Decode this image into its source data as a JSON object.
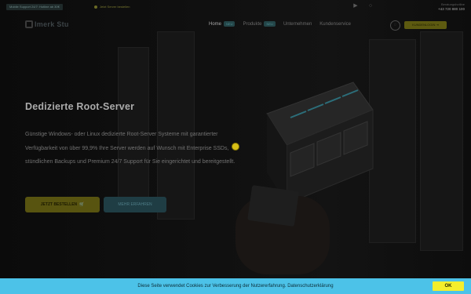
{
  "topbar": {
    "phone_badge": "Mobile Support 24/7: Hotline ab 30€",
    "offer_text": "Jetzt Server bestellen",
    "icon_bell": "bell-icon",
    "icon_user": "user-icon",
    "hotline_label": "Beratungshotline",
    "hotline_number": "+43 720 880 100"
  },
  "brand": {
    "name": "Imerk Stu"
  },
  "nav": {
    "items": [
      {
        "label": "Home",
        "pill": "NEU",
        "active": true
      },
      {
        "label": "Produkte",
        "pill": "NEU",
        "active": false
      },
      {
        "label": "Unternehmen",
        "pill": "",
        "active": false
      },
      {
        "label": "Kundenservice",
        "pill": "",
        "active": false
      }
    ],
    "circle_icon": "menu-circle-icon",
    "cta_label": "KUNDENLOGIN ⇥"
  },
  "hero": {
    "title": "Dedizierte Root-Server",
    "description": "Günstige Windows- oder Linux dedizierte Root-Server Systeme mit garantierter Verfügbarkeit von über 99,9% Ihre Server werden auf Wunsch mit Enterprise SSDs, stündlichen Backups und Premium 24/7 Support für Sie eingerichtet und bereitgestellt.",
    "primary_button": "JETZT BESTELLEN",
    "primary_icon": "cart-icon",
    "secondary_button": "MEHR ERFAHREN"
  },
  "cookie": {
    "text": "Diese Seite verwendet Cookies zur Verbesserung der Nutzererfahrung.",
    "link": "Datenschutzerklärung",
    "ok_label": "OK"
  },
  "colors": {
    "cookie_bg": "#4cc2e8",
    "ok_bg": "#f4ee2c",
    "cta_dim": "#585410",
    "secondary_dim": "#1f3d44"
  }
}
